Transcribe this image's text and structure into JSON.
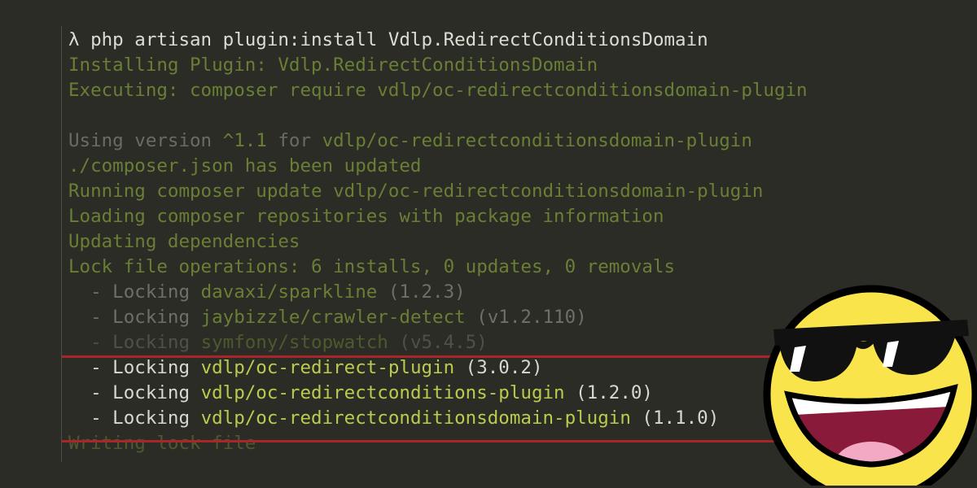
{
  "terminal": {
    "command": {
      "prompt": "λ",
      "text": " php artisan plugin:install Vdlp.RedirectConditionsDomain"
    },
    "installing": "Installing Plugin: Vdlp.RedirectConditionsDomain",
    "executing": "Executing: composer require vdlp/oc-redirectconditionsdomain-plugin",
    "using_version": {
      "prefix": "Using version ",
      "version": "^1.1",
      "for": " for ",
      "package": "vdlp/oc-redirectconditionsdomain-plugin"
    },
    "composer_updated": "./composer.json has been updated",
    "running_update": "Running composer update vdlp/oc-redirectconditionsdomain-plugin",
    "loading_repos": "Loading composer repositories with package information",
    "updating_deps": "Updating dependencies",
    "lock_ops": "Lock file operations: 6 installs, 0 updates, 0 removals",
    "locking_items": [
      {
        "prefix": "  - Locking ",
        "package": "davaxi/sparkline",
        "version": " (1.2.3)"
      },
      {
        "prefix": "  - Locking ",
        "package": "jaybizzle/crawler-detect",
        "version": " (v1.2.110)"
      },
      {
        "prefix": "  - Locking ",
        "package": "symfony/stopwatch",
        "version": " (v5.4.5)"
      },
      {
        "prefix": "  - Locking ",
        "package": "vdlp/oc-redirect-plugin",
        "version": " (3.0.2)"
      },
      {
        "prefix": "  - Locking ",
        "package": "vdlp/oc-redirectconditions-plugin",
        "version": " (1.2.0)"
      },
      {
        "prefix": "  - Locking ",
        "package": "vdlp/oc-redirectconditionsdomain-plugin",
        "version": " (1.1.0)"
      }
    ],
    "writing_lock": "Writing lock file"
  },
  "colors": {
    "background": "#2b2c26",
    "output_green": "#6a7e35",
    "highlight_green": "#bccb4e",
    "highlight_marker": "#a8262a"
  },
  "decoration": {
    "icon": "cool-sunglasses-smiley-icon"
  }
}
